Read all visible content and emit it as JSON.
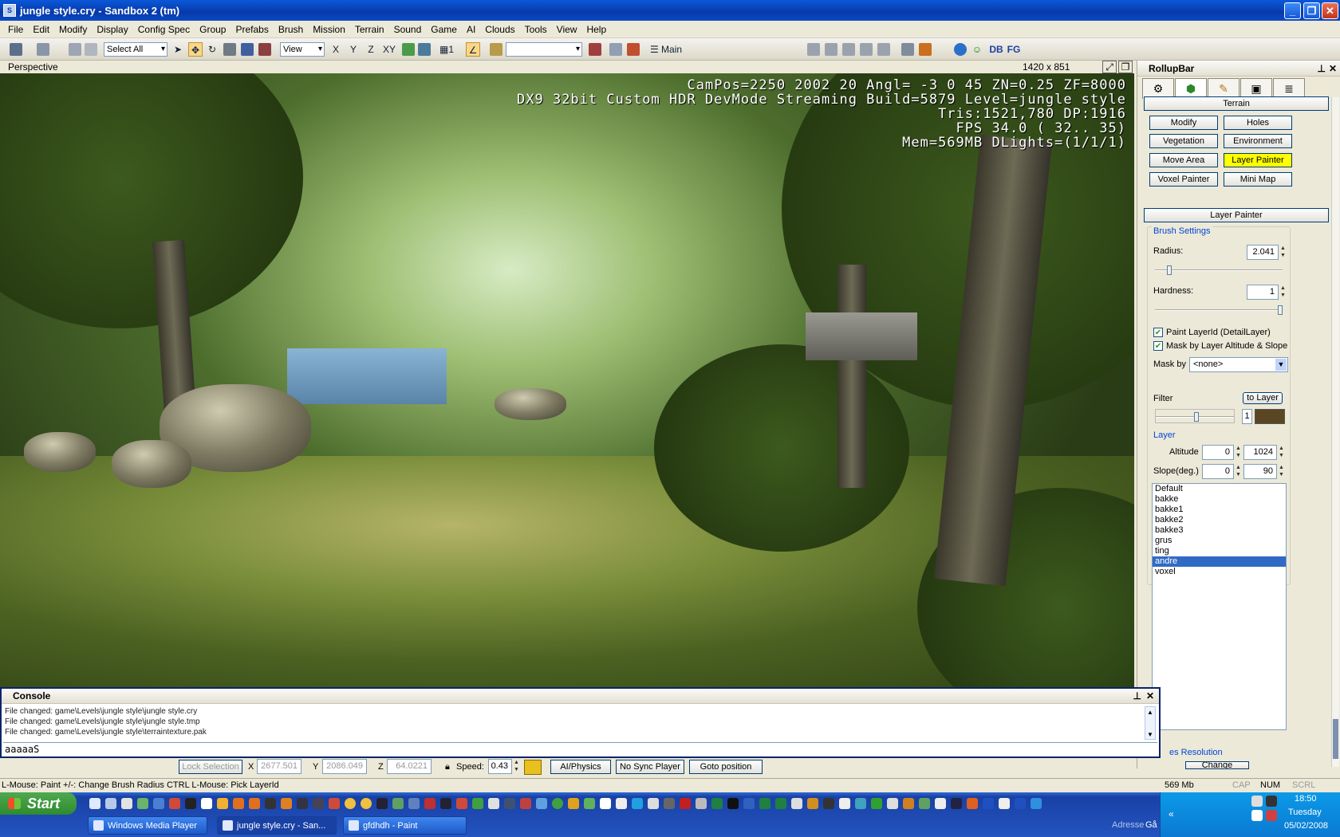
{
  "window": {
    "title": "jungle style.cry - Sandbox 2 (tm)"
  },
  "menu": [
    "File",
    "Edit",
    "Modify",
    "Display",
    "Config Spec",
    "Group",
    "Prefabs",
    "Brush",
    "Mission",
    "Terrain",
    "Sound",
    "Game",
    "AI",
    "Clouds",
    "Tools",
    "View",
    "Help"
  ],
  "toolbar": {
    "select_all": "Select All",
    "view_select": "View",
    "axis_x": "X",
    "axis_y": "Y",
    "axis_z": "Z",
    "axis_xy": "XY",
    "grid_value": "1",
    "main_label": "Main",
    "db_label": "DB",
    "fg_label": "FG"
  },
  "viewport": {
    "name": "Perspective",
    "resolution": "1420 x 851",
    "hud": [
      "CamPos=2250 2002  20 Angl= -3  0  45 ZN=0.25 ZF=8000",
      "DX9 32bit Custom HDR DevMode Streaming Build=5879 Level=jungle style",
      "Tris:1521,780  DP:1916",
      "FPS  34.0 ( 32.. 35)",
      "Mem=569MB DLights=(1/1/1)"
    ]
  },
  "rollup": {
    "title": "RollupBar",
    "section_terrain": "Terrain",
    "buttons": {
      "modify": "Modify",
      "holes": "Holes",
      "vegetation": "Vegetation",
      "environment": "Environment",
      "move_area": "Move Area",
      "layer_painter": "Layer Painter",
      "voxel_painter": "Voxel Painter",
      "mini_map": "Mini Map"
    },
    "section_layer_painter": "Layer Painter",
    "brush_settings": "Brush Settings",
    "radius_label": "Radius:",
    "radius_value": "2.041",
    "radius_fraction": 0.1,
    "hardness_label": "Hardness:",
    "hardness_value": "1",
    "hardness_fraction": 1.0,
    "paint_layerid": "Paint LayerId (DetailLayer)",
    "mask_altitude": "Mask by Layer Altitude & Slope",
    "mask_by_label": "Mask by",
    "mask_by_value": "<none>",
    "filter_label": "Filter",
    "to_layer": "to Layer",
    "filter_index": "1",
    "filter_color": "#5a4622",
    "layer_group": "Layer",
    "altitude_label": "Altitude",
    "altitude_min": "0",
    "altitude_max": "1024",
    "slope_label": "Slope(deg.)",
    "slope_min": "0",
    "slope_max": "90",
    "layers": [
      "Default",
      "bakke",
      "bakke1",
      "bakke2",
      "bakke3",
      "grus",
      "ting",
      "andre",
      "voxel"
    ],
    "selected_layer": "andre",
    "tex_resolution": "es Resolution",
    "change_btn": "Change"
  },
  "console": {
    "title": "Console",
    "lines": [
      "File changed: game\\Levels\\jungle style\\jungle style.cry",
      "File changed: game\\Levels\\jungle style\\jungle style.tmp",
      "File changed: game\\Levels\\jungle style\\terraintexture.pak"
    ],
    "input": "aaaaaS"
  },
  "bottombar": {
    "lock_selection": "Lock Selection",
    "x_label": "X",
    "x_value": "2677.501",
    "y_label": "Y",
    "y_value": "2086.049",
    "z_label": "Z",
    "z_value": "64.0221",
    "speed_label": "Speed:",
    "speed_value": "0.43",
    "ai_physics": "AI/Physics",
    "no_sync": "No Sync Player",
    "goto": "Goto position"
  },
  "status": {
    "hint": "L-Mouse: Paint    +/-: Change Brush Radius    CTRL L-Mouse: Pick LayerId",
    "memory": "569 Mb",
    "cap": "CAP",
    "num": "NUM",
    "scrl": "SCRL"
  },
  "taskbar": {
    "start": "Start",
    "tasks": [
      "Windows Media Player",
      "jungle style.cry - San...",
      "gfdhdh - Paint"
    ],
    "lang": "NO",
    "address": "Adresse",
    "goto": "Gå til",
    "time": "18:50",
    "day": "Tuesday",
    "date": "05/02/2008"
  }
}
